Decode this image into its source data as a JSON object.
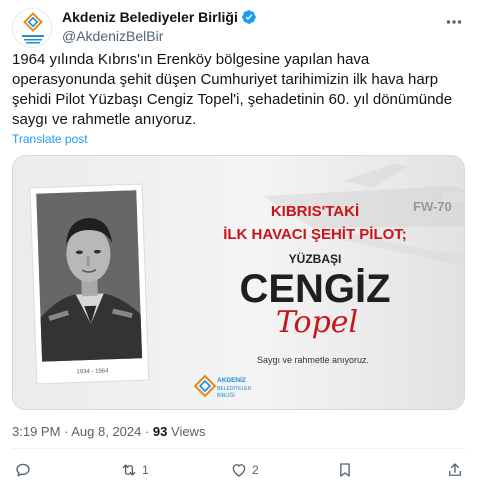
{
  "account": {
    "display_name": "Akdeniz Belediyeler Birliği",
    "handle": "@AkdenizBelBir"
  },
  "tweet": {
    "text": "1964 yılında Kıbrıs'ın Erenköy bölgesine yapılan hava operasyonunda şehit düşen Cumhuriyet tarihimizin ilk hava harp şehidi Pilot Yüzbaşı Cengiz Topel'i, şehadetinin 60. yıl dönümünde saygı ve rahmetle anıyoruz.",
    "translate_label": "Translate post",
    "time": "3:19 PM · Aug 8, 2024 · ",
    "views_count": "93",
    "views_label": " Views"
  },
  "media": {
    "line1": "KIBRIS'TAKİ",
    "line2": "İLK HAVACI ŞEHİT PİLOT;",
    "rank": "YÜZBAŞI",
    "name": "CENGİZ",
    "surname": "Topel",
    "photo_years": "1934 - 1964",
    "tagline": "Saygı ve rahmetle anıyoruz.",
    "plane_marking": "FW-70",
    "logo_line1": "AKDENİZ",
    "logo_line2": "BELEDİYELER",
    "logo_line3": "BİRLİĞİ"
  },
  "actions": {
    "replies": "",
    "reposts": "1",
    "likes": "2"
  },
  "colors": {
    "accent": "#1d9bf0",
    "muted": "#536471",
    "title_red": "#c8151b"
  },
  "icons": [
    "avatar-logo",
    "verified-badge-icon",
    "more-icon",
    "reply-icon",
    "repost-icon",
    "like-icon",
    "bookmark-icon",
    "share-icon"
  ]
}
